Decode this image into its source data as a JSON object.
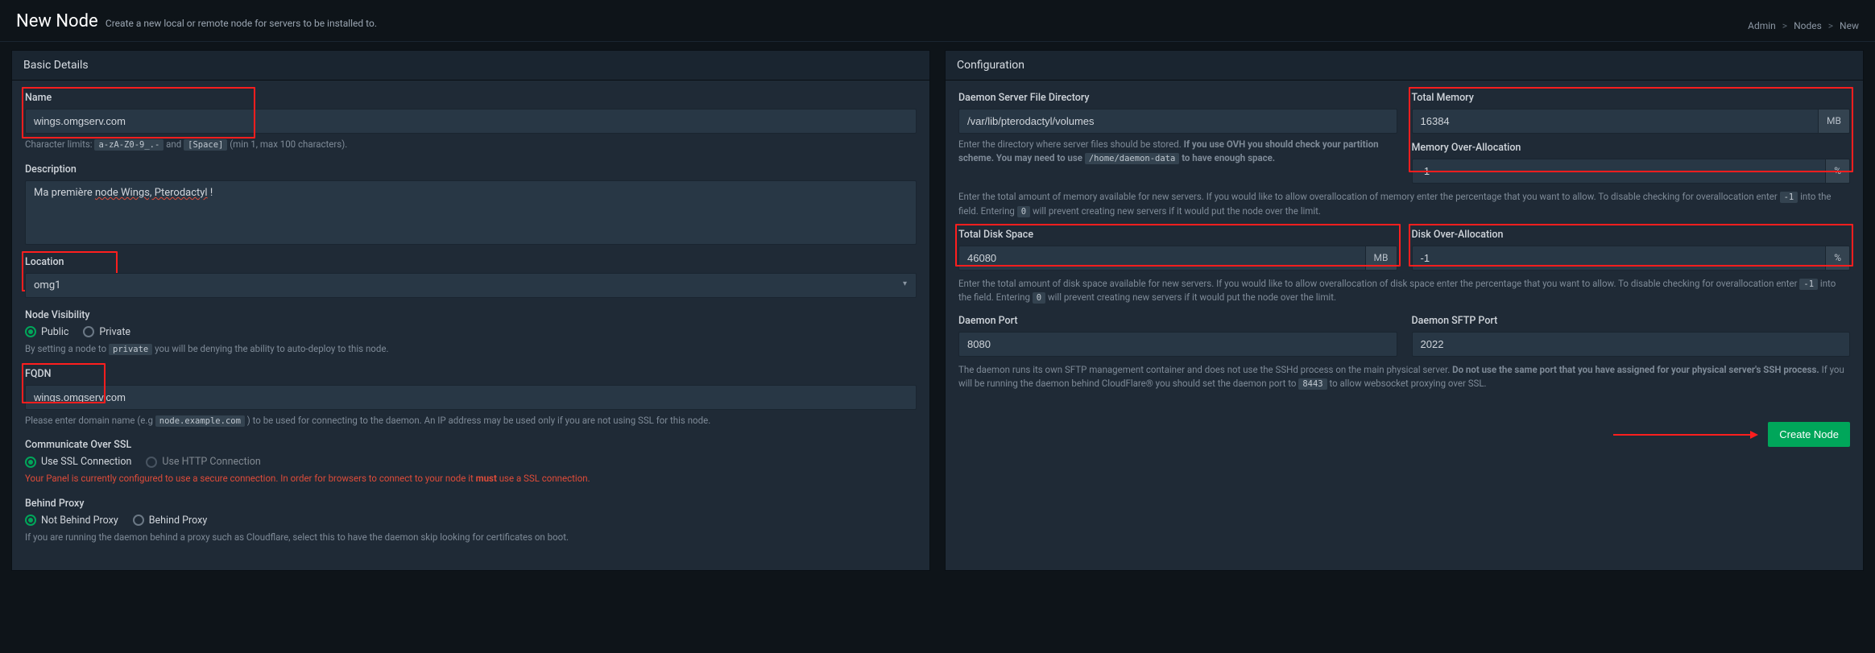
{
  "header": {
    "title": "New Node",
    "subtitle": "Create a new local or remote node for servers to be installed to."
  },
  "breadcrumb": {
    "admin": "Admin",
    "nodes": "Nodes",
    "new": "New"
  },
  "panels": {
    "basic": "Basic Details",
    "config": "Configuration"
  },
  "basic": {
    "name_label": "Name",
    "name_value": "wings.omgserv.com",
    "name_help_prefix": "Character limits:",
    "name_help_code1": "a-zA-Z0-9_.-",
    "name_help_and": "and",
    "name_help_code2": "[Space]",
    "name_help_suffix": "(min 1, max 100 characters).",
    "desc_label": "Description",
    "desc_value_a": "Ma première ",
    "desc_value_b": "node Wings, Pterodactyl",
    "desc_value_c": " !",
    "loc_label": "Location",
    "loc_value": "omg1",
    "vis_label": "Node Visibility",
    "vis_public": "Public",
    "vis_private": "Private",
    "vis_help_a": "By setting a node to",
    "vis_help_code": "private",
    "vis_help_b": "you will be denying the ability to auto-deploy to this node.",
    "fqdn_label": "FQDN",
    "fqdn_value": "wings.omgserv.com",
    "fqdn_help_a": "Please enter domain name (e.g",
    "fqdn_help_code": "node.example.com",
    "fqdn_help_b": ") to be used for connecting to the daemon. An IP address may be used only if you are not using SSL for this node.",
    "ssl_label": "Communicate Over SSL",
    "ssl_use": "Use SSL Connection",
    "ssl_http": "Use HTTP Connection",
    "ssl_warn_a": "Your Panel is currently configured to use a secure connection. In order for browsers to connect to your node it ",
    "ssl_warn_b": "must",
    "ssl_warn_c": " use a SSL connection.",
    "proxy_label": "Behind Proxy",
    "proxy_no": "Not Behind Proxy",
    "proxy_yes": "Behind Proxy",
    "proxy_help": "If you are running the daemon behind a proxy such as Cloudflare, select this to have the daemon skip looking for certificates on boot."
  },
  "config": {
    "dir_label": "Daemon Server File Directory",
    "dir_value": "/var/lib/pterodactyl/volumes",
    "dir_help_a": "Enter the directory where server files should be stored. ",
    "dir_help_b": "If you use OVH you should check your partition scheme. You may need to use",
    "dir_help_code": "/home/daemon-data",
    "dir_help_c": "to have enough space.",
    "mem_label": "Total Memory",
    "mem_value": "16384",
    "mem_unit": "MB",
    "memoa_label": "Memory Over-Allocation",
    "memoa_value": "-1",
    "memoa_unit": "%",
    "mem_help_a": "Enter the total amount of memory available for new servers. If you would like to allow overallocation of memory enter the percentage that you want to allow. To disable checking for overallocation enter",
    "mem_help_code1": "-1",
    "mem_help_b": "into the field. Entering",
    "mem_help_code2": "0",
    "mem_help_c": "will prevent creating new servers if it would put the node over the limit.",
    "disk_label": "Total Disk Space",
    "disk_value": "46080",
    "disk_unit": "MB",
    "diskoa_label": "Disk Over-Allocation",
    "diskoa_value": "-1",
    "diskoa_unit": "%",
    "disk_help_a": "Enter the total amount of disk space available for new servers. If you would like to allow overallocation of disk space enter the percentage that you want to allow. To disable checking for overallocation enter",
    "disk_help_code1": "-1",
    "disk_help_b": "into the field. Entering",
    "disk_help_code2": "0",
    "disk_help_c": "will prevent creating new servers if it would put the node over the limit.",
    "port_label": "Daemon Port",
    "port_value": "8080",
    "sftp_label": "Daemon SFTP Port",
    "sftp_value": "2022",
    "port_help_a": "The daemon runs its own SFTP management container and does not use the SSHd process on the main physical server. ",
    "port_help_b": "Do not use the same port that you have assigned for your physical server's SSH process.",
    "port_help_c": " If you will be running the daemon behind CloudFlare® you should set the daemon port to",
    "port_help_code": "8443",
    "port_help_d": "to allow websocket proxying over SSL.",
    "create_btn": "Create Node"
  }
}
